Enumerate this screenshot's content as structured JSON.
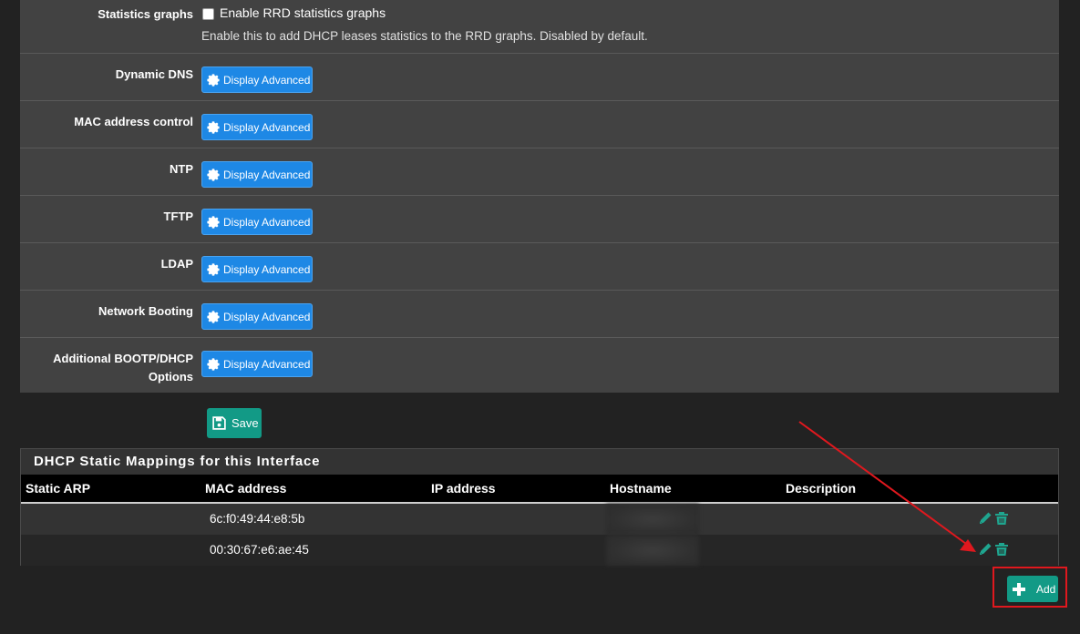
{
  "settings": {
    "statistics": {
      "label": "Statistics graphs",
      "checkbox_label": "Enable RRD statistics graphs",
      "help": "Enable this to add DHCP leases statistics to the RRD graphs. Disabled by default.",
      "checked": false
    },
    "advanced_button_label": "Display Advanced",
    "rows": [
      {
        "label": "Dynamic DNS"
      },
      {
        "label": "MAC address control"
      },
      {
        "label": "NTP"
      },
      {
        "label": "TFTP"
      },
      {
        "label": "LDAP"
      },
      {
        "label": "Network Booting"
      },
      {
        "label_line1": "Additional BOOTP/DHCP",
        "label_line2": "Options"
      }
    ]
  },
  "save_label": "Save",
  "mappings": {
    "title": "DHCP Static Mappings for this Interface",
    "columns": [
      "Static ARP",
      "MAC address",
      "IP address",
      "Hostname",
      "Description"
    ],
    "rows": [
      {
        "static_arp": "",
        "mac": "6c:f0:49:44:e8:5b",
        "ip": "",
        "hostname": "",
        "description": ""
      },
      {
        "static_arp": "",
        "mac": "00:30:67:e6:ae:45",
        "ip": "",
        "hostname": "",
        "description": ""
      }
    ]
  },
  "add_label": "Add",
  "colors": {
    "primary_button": "#1e88e5",
    "success_button": "#129a86",
    "annotation": "#e0181e"
  },
  "icons": [
    "gear-icon",
    "save-icon",
    "pencil-icon",
    "trash-icon",
    "plus-icon"
  ]
}
